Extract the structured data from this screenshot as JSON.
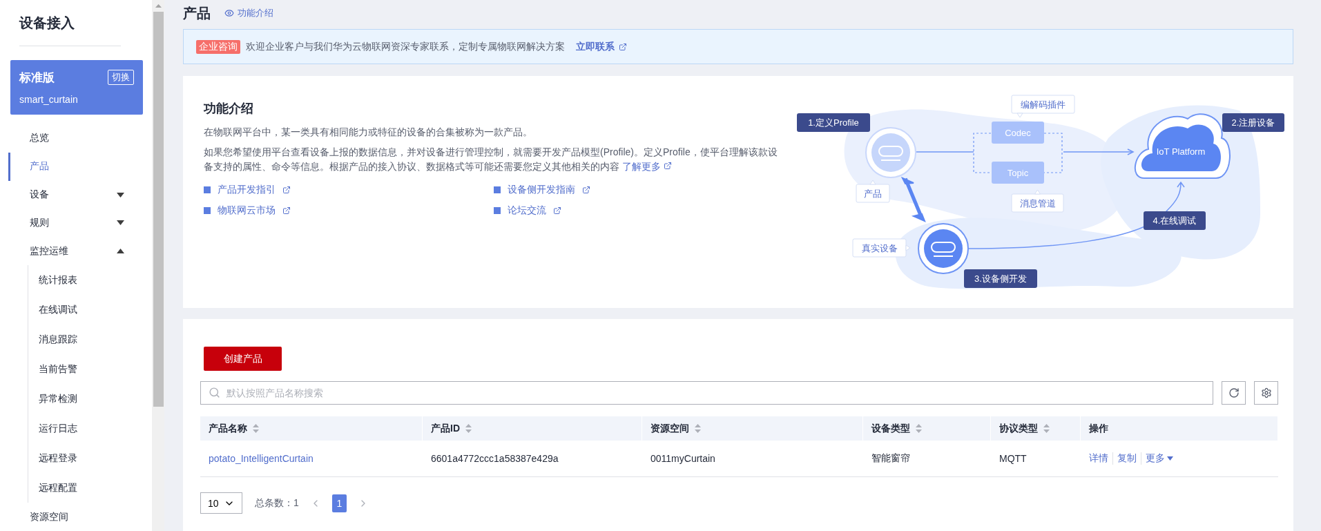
{
  "sidebar": {
    "title": "设备接入",
    "edition": {
      "name": "标准版",
      "switch_label": "切换",
      "instance": "smart_curtain"
    },
    "items": [
      {
        "label": "总览",
        "selected": false
      },
      {
        "label": "产品",
        "selected": true
      },
      {
        "label": "设备",
        "selected": false,
        "expanded": false
      },
      {
        "label": "规则",
        "selected": false,
        "expanded": false
      },
      {
        "label": "监控运维",
        "selected": false,
        "expanded": true,
        "children": [
          {
            "label": "统计报表",
            "selected": false
          },
          {
            "label": "在线调试",
            "selected": false
          },
          {
            "label": "消息跟踪",
            "selected": false
          },
          {
            "label": "当前告警",
            "selected": false
          },
          {
            "label": "异常检测",
            "selected": false
          },
          {
            "label": "运行日志",
            "selected": false
          },
          {
            "label": "远程登录",
            "selected": false
          },
          {
            "label": "远程配置",
            "selected": false
          }
        ]
      },
      {
        "label": "资源空间",
        "selected": false
      }
    ]
  },
  "header": {
    "title": "产品",
    "link": "功能介绍"
  },
  "banner": {
    "tag": "企业咨询",
    "text": "欢迎企业客户与我们华为云物联网资深专家联系，定制专属物联网解决方案",
    "link": "立即联系"
  },
  "intro": {
    "title": "功能介绍",
    "paragraphs": [
      "在物联网平台中，某一类具有相同能力或特征的设备的合集被称为一款产品。",
      "如果您希望使用平台查看设备上报的数据信息，并对设备进行管理控制，就需要开发产品模型(Profile)。定义Profile，使平台理解该款设备支持的属性、命令等信息。根据产品的接入协议、数据格式等可能还需要您定义其他相关的内容"
    ],
    "more_link": "了解更多",
    "links": [
      "产品开发指引",
      "设备侧开发指南",
      "物联网云市场",
      "论坛交流"
    ]
  },
  "diagram": {
    "steps": [
      "1.定义Profile",
      "2.注册设备",
      "3.设备侧开发",
      "4.在线调试"
    ],
    "callouts": [
      "编解码插件",
      "消息管道",
      "产品",
      "真实设备"
    ],
    "channels": [
      "Codec",
      "Topic"
    ],
    "platform": "IoT Platform"
  },
  "products": {
    "create_button": "创建产品",
    "search": {
      "placeholder": "默认按照产品名称搜索"
    },
    "columns": [
      {
        "label": "产品名称",
        "sortable": true
      },
      {
        "label": "产品ID",
        "sortable": true
      },
      {
        "label": "资源空间",
        "sortable": true
      },
      {
        "label": "设备类型",
        "sortable": true
      },
      {
        "label": "协议类型",
        "sortable": true
      },
      {
        "label": "操作",
        "sortable": false
      }
    ],
    "rows": [
      {
        "cells": [
          "potato_IntelligentCurtain",
          "6601a4772ccc1a58387e429a",
          "0011myCurtain",
          "智能窗帘",
          "MQTT"
        ],
        "actions": [
          "详情",
          "复制",
          "更多"
        ]
      }
    ],
    "pagination": {
      "page_size": "10",
      "total_label": "总条数：",
      "total": "1",
      "pages": [
        {
          "label": "1",
          "selected": true
        }
      ]
    }
  }
}
